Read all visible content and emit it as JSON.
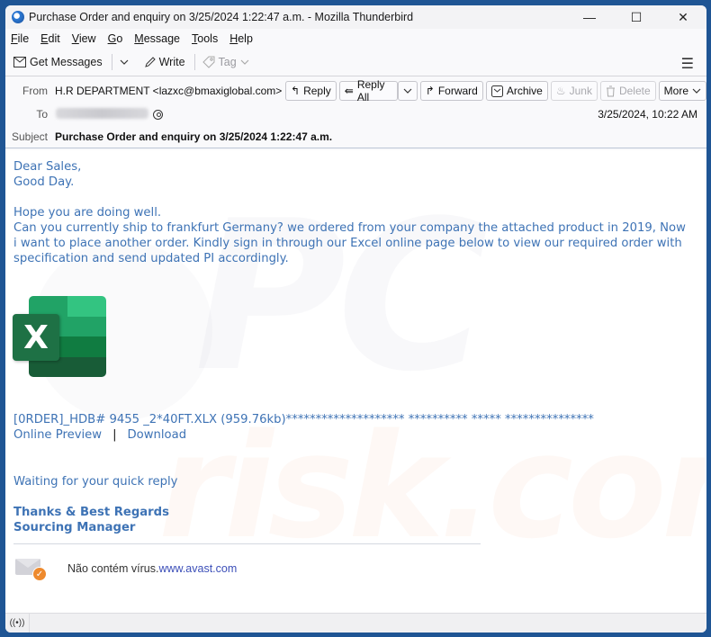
{
  "window": {
    "title": "Purchase Order and enquiry on 3/25/2024 1:22:47 a.m. - Mozilla Thunderbird",
    "controls": {
      "minimize": "—",
      "maximize": "☐",
      "close": "✕"
    }
  },
  "menu": [
    {
      "key": "F",
      "rest": "ile"
    },
    {
      "key": "E",
      "rest": "dit"
    },
    {
      "key": "V",
      "rest": "iew"
    },
    {
      "key": "G",
      "rest": "o"
    },
    {
      "key": "M",
      "rest": "essage"
    },
    {
      "key": "T",
      "rest": "ools"
    },
    {
      "key": "H",
      "rest": "elp"
    }
  ],
  "toolbar": {
    "get_messages": "Get Messages",
    "write": "Write",
    "tag": "Tag"
  },
  "header": {
    "from_label": "From",
    "from_value": "H.R DEPARTMENT <lazxc@bmaxiglobal.com>",
    "to_label": "To",
    "date": "3/25/2024, 10:22 AM",
    "subject_label": "Subject",
    "subject_value": "Purchase Order and enquiry on 3/25/2024 1:22:47 a.m.",
    "actions": {
      "reply": "Reply",
      "reply_all": "Reply All",
      "forward": "Forward",
      "archive": "Archive",
      "junk": "Junk",
      "delete": "Delete",
      "more": "More"
    }
  },
  "body": {
    "greeting1": "Dear Sales,",
    "greeting2": "Good Day.",
    "line1": "Hope you are doing well.",
    "paragraph": "Can you currently ship to frankfurt Germany? we ordered from your company the attached product in 2019, Now i want to place another order. Kindly sign in through our Excel online page below to view our required order with specification and send updated PI accordingly.",
    "attachment_name": "[0RDER]_HDB#  9455 _2*40FT.XLX (959.76kb)******************** ********** ***** ***************",
    "online_preview": "Online Preview",
    "link_separator": "|",
    "download": "Download",
    "waiting": "Waiting for your quick reply",
    "sign1": "Thanks & Best Regards",
    "sign2": "Sourcing Manager",
    "avast_text": "Não contém vírus.",
    "avast_link": "www.avast.com"
  },
  "watermark": {
    "line1": "PC",
    "line2": "risk.com"
  },
  "colors": {
    "body_text": "#3e73b5",
    "excel_green": "#1e7145",
    "avast_orange": "#ee8a2e",
    "frame_blue": "#1f5594"
  }
}
